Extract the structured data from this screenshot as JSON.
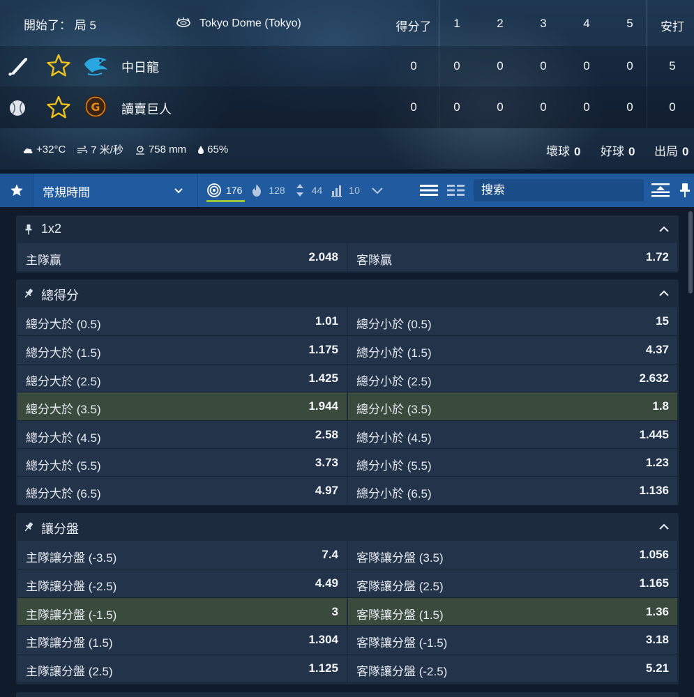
{
  "scoreboard": {
    "status": "開始了：  局 5",
    "venue": "Tokyo Dome (Tokyo)",
    "columns": {
      "score": "得分了",
      "i1": "1",
      "i2": "2",
      "i3": "3",
      "i4": "4",
      "i5": "5",
      "hits": "安打"
    },
    "teams": [
      {
        "name": "中日龍",
        "score": "0",
        "innings": [
          "0",
          "0",
          "0",
          "0",
          "0"
        ],
        "hits": "5",
        "logo_color": "#2aa6e0",
        "role": "batting"
      },
      {
        "name": "讀賣巨人",
        "score": "0",
        "innings": [
          "0",
          "0",
          "0",
          "0",
          "0"
        ],
        "hits": "0",
        "logo_color": "#e8891c",
        "role": "pitching"
      }
    ],
    "weather": {
      "temp": "+32°C",
      "wind": "7 米/秒",
      "pressure": "758 mm",
      "humidity": "65%"
    },
    "count": {
      "balls_label": "壞球",
      "balls": "0",
      "strikes_label": "好球",
      "strikes": "0",
      "outs_label": "出局",
      "outs": "0"
    },
    "star_color": "#f2c21b"
  },
  "toolbar": {
    "period_select": "常規時間",
    "filters": [
      {
        "icon": "target-icon",
        "count": "176",
        "active": true
      },
      {
        "icon": "fire-icon",
        "count": "128",
        "active": false
      },
      {
        "icon": "up-down-icon",
        "count": "44",
        "active": false
      },
      {
        "icon": "bar-chart-icon",
        "count": "10",
        "active": false
      }
    ],
    "search_placeholder": "搜索",
    "accent": "#9bc53d"
  },
  "markets": [
    {
      "title": "1x2",
      "rows": [
        {
          "left_label": "主隊贏",
          "left_odds": "2.048",
          "right_label": "客隊贏",
          "right_odds": "1.72",
          "highlight": false
        }
      ]
    },
    {
      "title": "總得分",
      "rows": [
        {
          "left_label": "總分大於 (0.5)",
          "left_odds": "1.01",
          "right_label": "總分小於 (0.5)",
          "right_odds": "15",
          "highlight": false
        },
        {
          "left_label": "總分大於 (1.5)",
          "left_odds": "1.175",
          "right_label": "總分小於 (1.5)",
          "right_odds": "4.37",
          "highlight": false
        },
        {
          "left_label": "總分大於 (2.5)",
          "left_odds": "1.425",
          "right_label": "總分小於 (2.5)",
          "right_odds": "2.632",
          "highlight": false
        },
        {
          "left_label": "總分大於 (3.5)",
          "left_odds": "1.944",
          "right_label": "總分小於 (3.5)",
          "right_odds": "1.8",
          "highlight": true
        },
        {
          "left_label": "總分大於 (4.5)",
          "left_odds": "2.58",
          "right_label": "總分小於 (4.5)",
          "right_odds": "1.445",
          "highlight": false
        },
        {
          "left_label": "總分大於 (5.5)",
          "left_odds": "3.73",
          "right_label": "總分小於 (5.5)",
          "right_odds": "1.23",
          "highlight": false
        },
        {
          "left_label": "總分大於 (6.5)",
          "left_odds": "4.97",
          "right_label": "總分小於 (6.5)",
          "right_odds": "1.136",
          "highlight": false
        }
      ]
    },
    {
      "title": "讓分盤",
      "rows": [
        {
          "left_label": "主隊讓分盤 (-3.5)",
          "left_odds": "7.4",
          "right_label": "客隊讓分盤 (3.5)",
          "right_odds": "1.056",
          "highlight": false
        },
        {
          "left_label": "主隊讓分盤 (-2.5)",
          "left_odds": "4.49",
          "right_label": "客隊讓分盤 (2.5)",
          "right_odds": "1.165",
          "highlight": false
        },
        {
          "left_label": "主隊讓分盤 (-1.5)",
          "left_odds": "3",
          "right_label": "客隊讓分盤 (1.5)",
          "right_odds": "1.36",
          "highlight": true
        },
        {
          "left_label": "主隊讓分盤 (1.5)",
          "left_odds": "1.304",
          "right_label": "客隊讓分盤 (-1.5)",
          "right_odds": "3.18",
          "highlight": false
        },
        {
          "left_label": "主隊讓分盤 (2.5)",
          "left_odds": "1.125",
          "right_label": "客隊讓分盤 (-2.5)",
          "right_odds": "5.21",
          "highlight": false
        }
      ]
    }
  ]
}
